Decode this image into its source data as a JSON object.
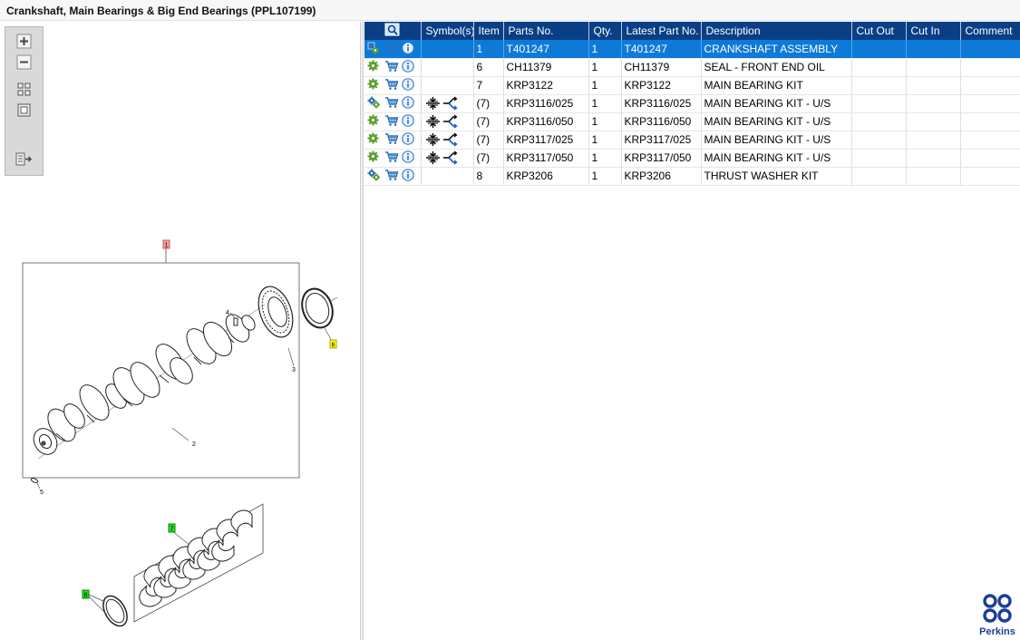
{
  "title": "Crankshaft, Main Bearings & Big End Bearings (PPL107199)",
  "toolbar": {
    "buttons": [
      "zoom-in-icon",
      "zoom-out-icon",
      "fit-all-icon",
      "fit-window-icon",
      "list-export-icon"
    ]
  },
  "callouts": {
    "c1": "1",
    "c2": "2",
    "c3": "3",
    "c4": "4",
    "c5": "5",
    "c6": "6",
    "c7": "7",
    "c8": "8"
  },
  "table": {
    "columns": [
      "",
      "Symbol(s)",
      "Item",
      "Parts No.",
      "Qty.",
      "Latest Part No.",
      "Description",
      "Cut Out",
      "Cut In",
      "Comment"
    ],
    "rows": [
      {
        "item": "1",
        "part_no": "T401247",
        "qty": "1",
        "latest": "T401247",
        "description": "CRANKSHAFT ASSEMBLY",
        "cut_out": "",
        "cut_in": "",
        "comment": "",
        "selected": true,
        "symbols": false,
        "gear_type": "assembly"
      },
      {
        "item": "6",
        "part_no": "CH11379",
        "qty": "1",
        "latest": "CH11379",
        "description": "SEAL - FRONT END OIL",
        "cut_out": "",
        "cut_in": "",
        "comment": "",
        "selected": false,
        "symbols": false,
        "gear_type": "single"
      },
      {
        "item": "7",
        "part_no": "KRP3122",
        "qty": "1",
        "latest": "KRP3122",
        "description": "MAIN BEARING KIT",
        "cut_out": "",
        "cut_in": "",
        "comment": "",
        "selected": false,
        "symbols": false,
        "gear_type": "single"
      },
      {
        "item": "(7)",
        "part_no": "KRP3116/025",
        "qty": "1",
        "latest": "KRP3116/025",
        "description": "MAIN BEARING KIT - U/S",
        "cut_out": "",
        "cut_in": "",
        "comment": "",
        "selected": false,
        "symbols": true,
        "gear_type": "kit"
      },
      {
        "item": "(7)",
        "part_no": "KRP3116/050",
        "qty": "1",
        "latest": "KRP3116/050",
        "description": "MAIN BEARING KIT - U/S",
        "cut_out": "",
        "cut_in": "",
        "comment": "",
        "selected": false,
        "symbols": true,
        "gear_type": "single"
      },
      {
        "item": "(7)",
        "part_no": "KRP3117/025",
        "qty": "1",
        "latest": "KRP3117/025",
        "description": "MAIN BEARING KIT - U/S",
        "cut_out": "",
        "cut_in": "",
        "comment": "",
        "selected": false,
        "symbols": true,
        "gear_type": "single"
      },
      {
        "item": "(7)",
        "part_no": "KRP3117/050",
        "qty": "1",
        "latest": "KRP3117/050",
        "description": "MAIN BEARING KIT - U/S",
        "cut_out": "",
        "cut_in": "",
        "comment": "",
        "selected": false,
        "symbols": true,
        "gear_type": "single"
      },
      {
        "item": "8",
        "part_no": "KRP3206",
        "qty": "1",
        "latest": "KRP3206",
        "description": "THRUST WASHER KIT",
        "cut_out": "",
        "cut_in": "",
        "comment": "",
        "selected": false,
        "symbols": false,
        "gear_type": "kit"
      }
    ]
  },
  "brand": {
    "name": "Perkins",
    "color": "#1b3f94"
  },
  "colors": {
    "header": "#0a3f86",
    "selected": "#0e7ad8",
    "gear": "#5aa02c",
    "cart": "#2a6fc0",
    "info": "#3b7fd0",
    "callout_red": "#f4a0a0",
    "callout_yellow": "#ffff00",
    "callout_green": "#22dd22"
  }
}
